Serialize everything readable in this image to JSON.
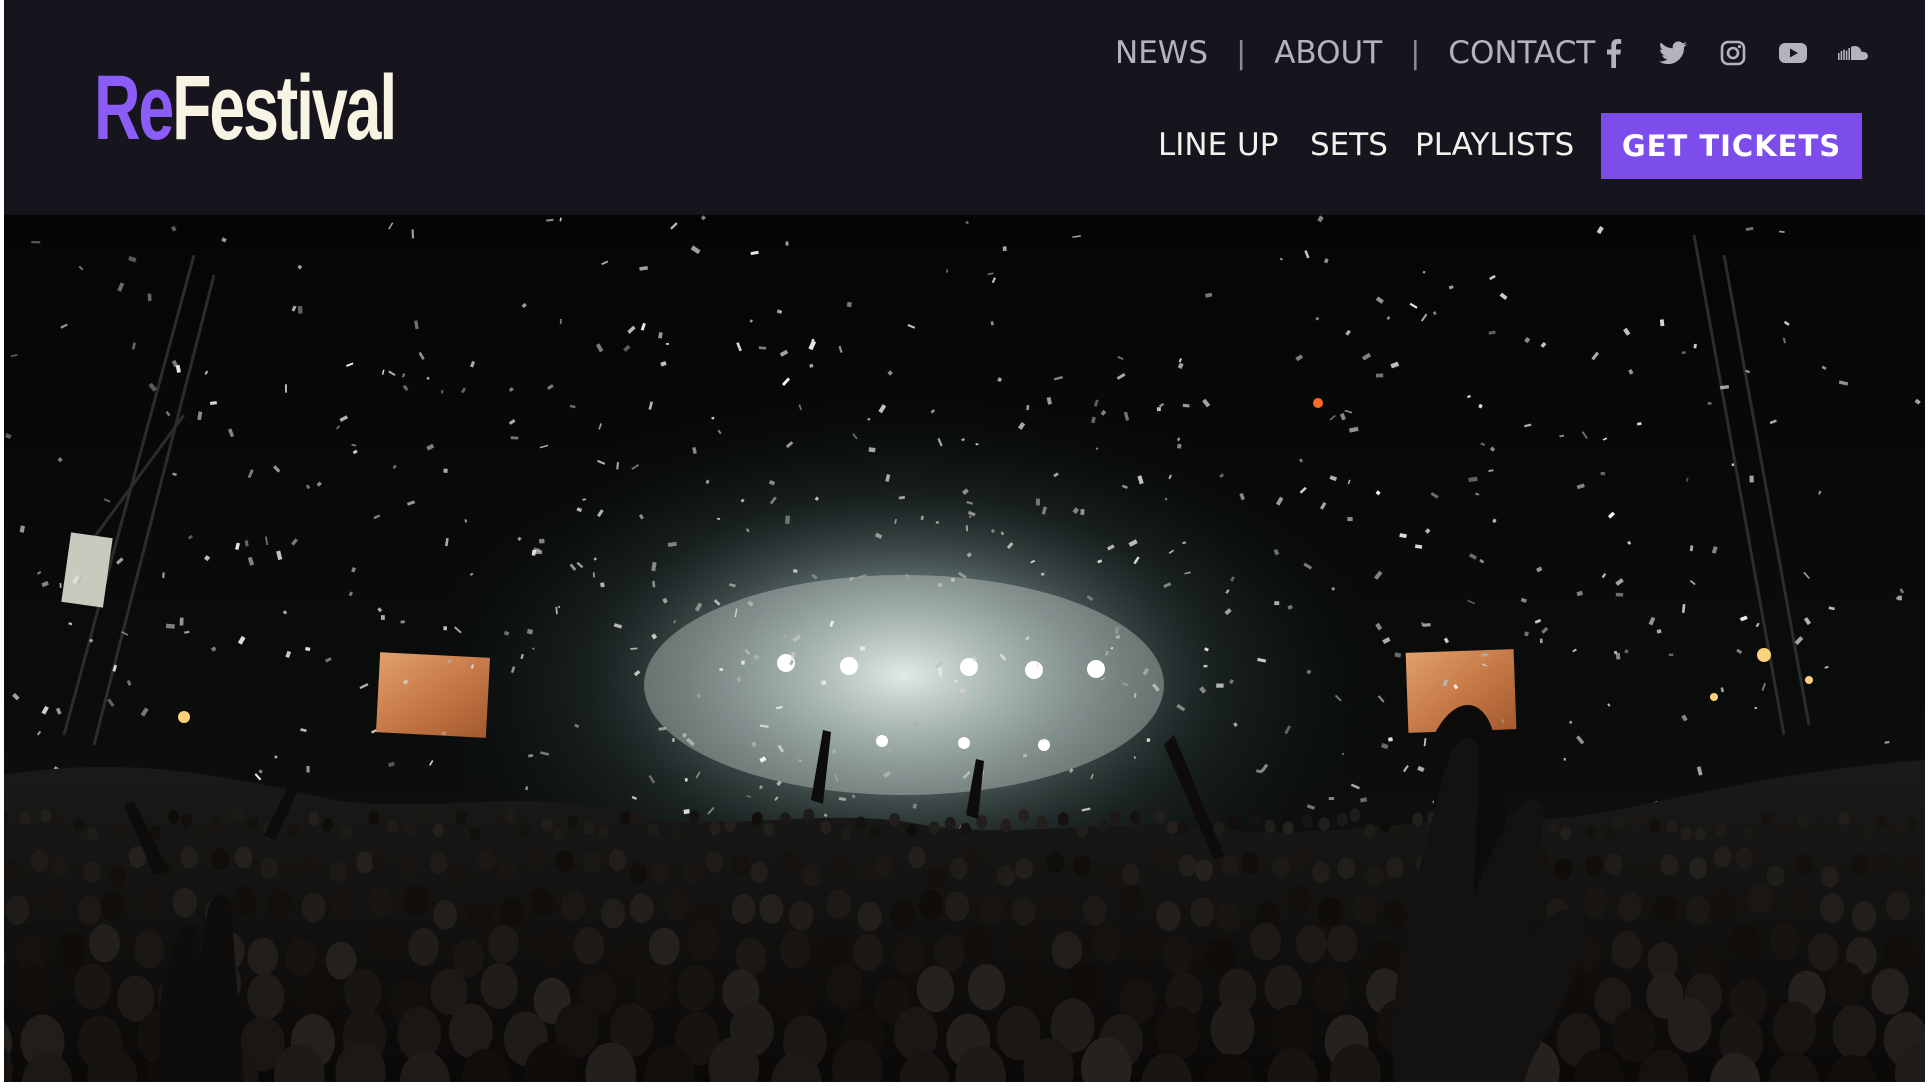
{
  "brand": {
    "logo_prefix": "Re",
    "logo_suffix": "Festival",
    "accent_color": "#7c4dea",
    "background_color": "#16151d"
  },
  "utility_nav": {
    "items": [
      {
        "label": "NEWS"
      },
      {
        "label": "ABOUT"
      },
      {
        "label": "CONTACT"
      }
    ],
    "separator": "|"
  },
  "social": {
    "icons": [
      "facebook-icon",
      "twitter-icon",
      "instagram-icon",
      "youtube-icon",
      "soundcloud-icon"
    ]
  },
  "main_nav": {
    "items": [
      {
        "label": "LINE UP"
      },
      {
        "label": "SETS"
      },
      {
        "label": "PLAYLISTS"
      }
    ],
    "cta_label": "GET TICKETS"
  },
  "hero": {
    "image": "concert-crowd-confetti-photo"
  }
}
